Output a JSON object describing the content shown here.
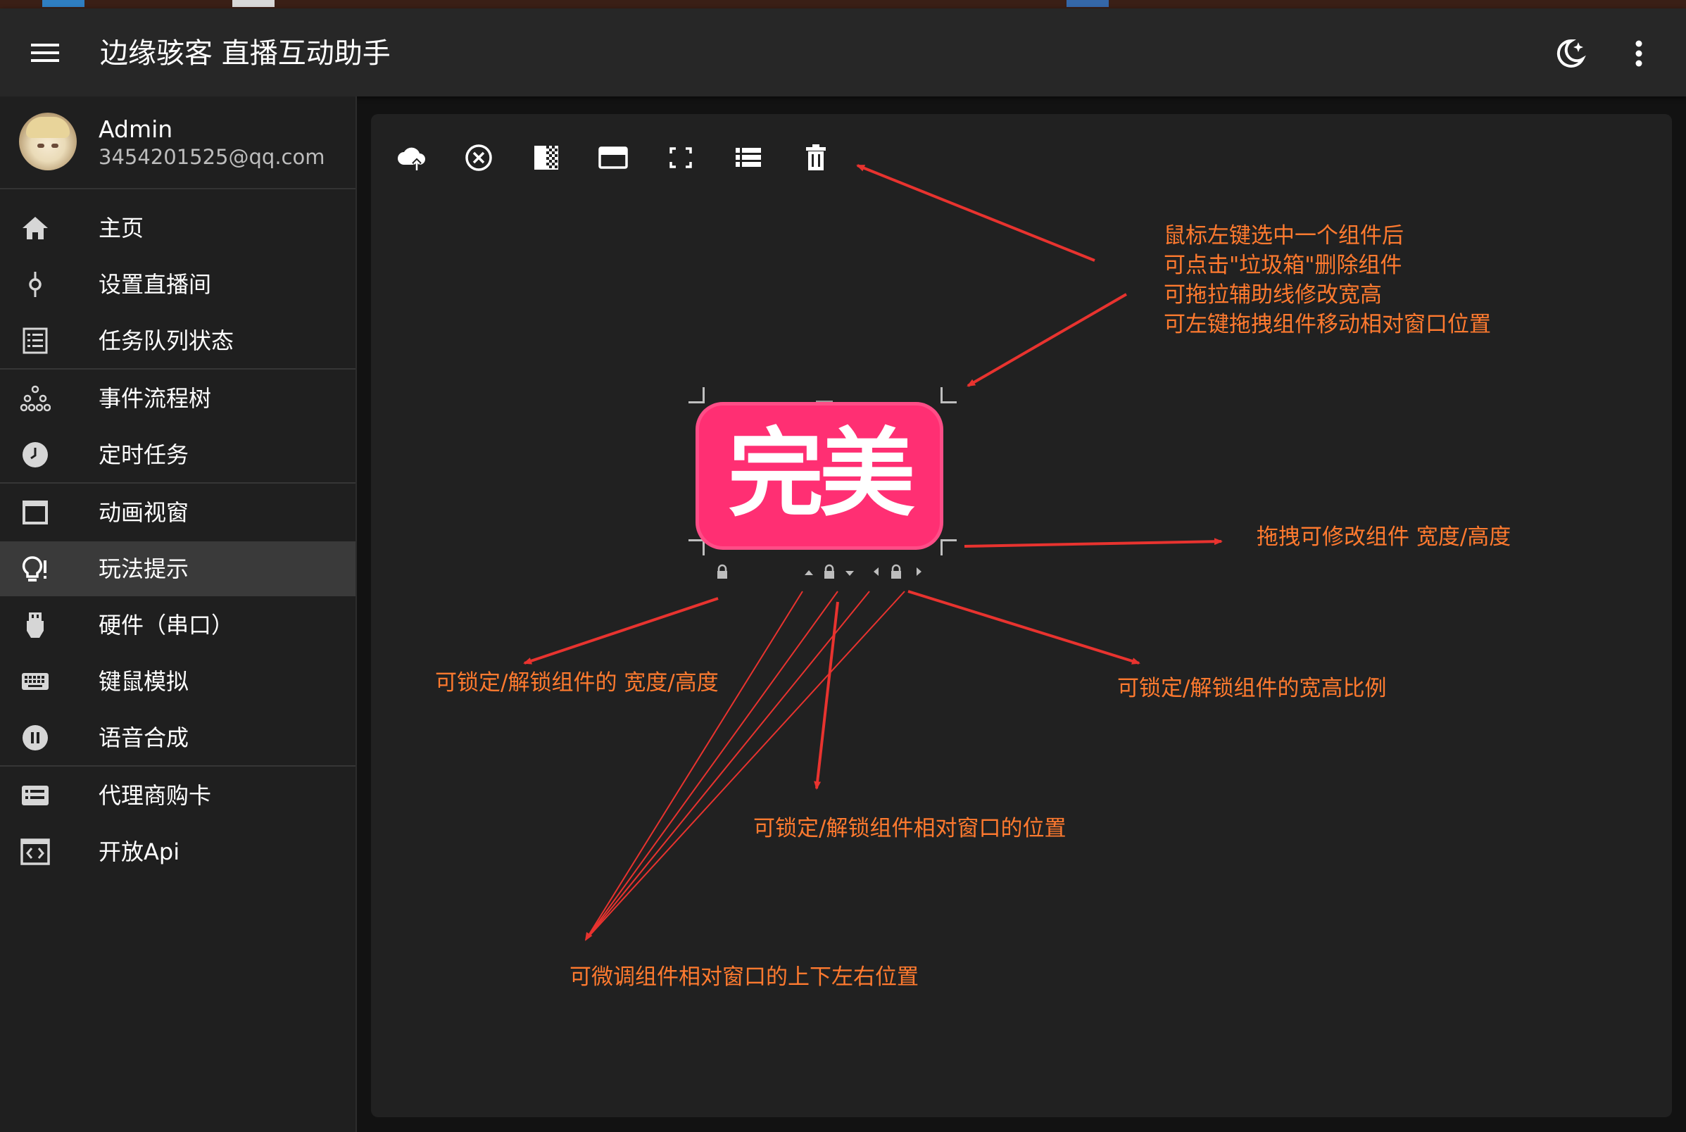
{
  "app": {
    "title": "边缘骇客 直播互动助手",
    "icons": {
      "menu": "menu-icon",
      "theme": "theme-toggle-icon",
      "more": "more-vert-icon"
    }
  },
  "profile": {
    "name": "Admin",
    "email": "3454201525@qq.com"
  },
  "nav": {
    "items": [
      {
        "label": "主页",
        "icon": "home-icon"
      },
      {
        "label": "设置直播间",
        "icon": "settings-live-icon"
      },
      {
        "label": "任务队列状态",
        "icon": "list-icon"
      },
      {
        "label": "事件流程树",
        "icon": "tree-icon"
      },
      {
        "label": "定时任务",
        "icon": "clock-icon"
      },
      {
        "label": "动画视窗",
        "icon": "window-icon"
      },
      {
        "label": "玩法提示",
        "icon": "lightbulb-icon"
      },
      {
        "label": "硬件（串口）",
        "icon": "usb-icon"
      },
      {
        "label": "键鼠模拟",
        "icon": "keyboard-icon"
      },
      {
        "label": "语音合成",
        "icon": "voice-icon"
      },
      {
        "label": "代理商购卡",
        "icon": "card-icon"
      },
      {
        "label": "开放Api",
        "icon": "api-icon"
      }
    ],
    "active": "玩法提示"
  },
  "toolbar": {
    "tools": [
      "upload-cloud-icon",
      "close-circle-icon",
      "checker-opacity-icon",
      "window-bar-icon",
      "fullscreen-icon",
      "list-view-icon",
      "trash-icon"
    ]
  },
  "component": {
    "text": "完美",
    "color": "#ff2f73"
  },
  "annotations": {
    "top_right": [
      "鼠标左键选中一个组件后",
      "可点击\"垃圾箱\"删除组件",
      "可拖拉辅助线修改宽高",
      "可左键拖拽组件移动相对窗口位置"
    ],
    "resize": "拖拽可修改组件 宽度/高度",
    "lock_size": "可锁定/解锁组件的 宽度/高度",
    "lock_ratio": "可锁定/解锁组件的宽高比例",
    "lock_position": "可锁定/解锁组件相对窗口的位置",
    "nudge": "可微调组件相对窗口的上下左右位置"
  },
  "colors": {
    "annotation_text": "#ff7a2f",
    "annotation_arrow": "#e8332f",
    "active_nav": "#3a3a3a"
  }
}
